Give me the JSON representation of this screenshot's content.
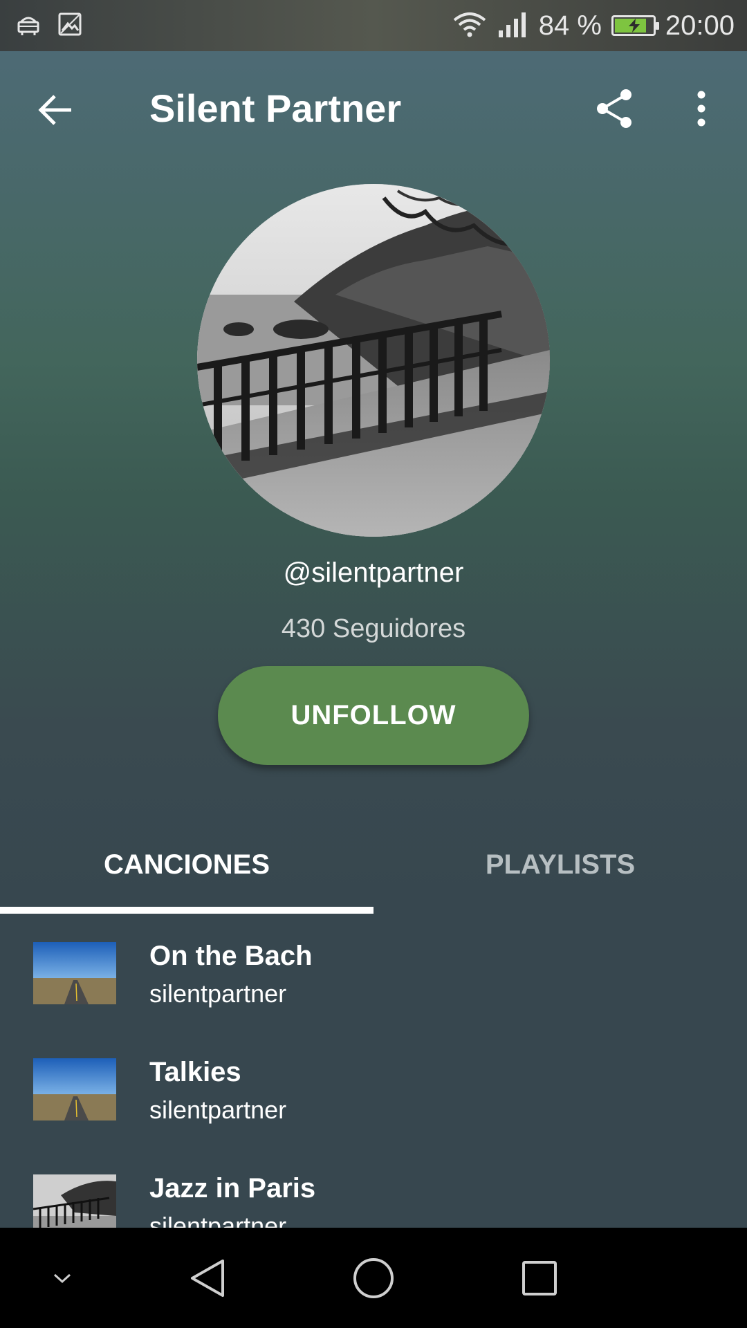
{
  "status_bar": {
    "battery_percent": "84 %",
    "battery_level": 0.84,
    "time": "20:00",
    "icons": [
      "android-icon",
      "image-icon",
      "wifi-icon",
      "signal-icon",
      "battery-charging-icon"
    ]
  },
  "toolbar": {
    "title": "Silent Partner",
    "back_icon": "arrow-back-icon",
    "share_icon": "share-icon",
    "more_icon": "more-vert-icon"
  },
  "profile": {
    "handle": "@silentpartner",
    "followers": "430 Seguidores",
    "unfollow_label": "UNFOLLOW"
  },
  "tabs": [
    {
      "label": "CANCIONES",
      "selected": true
    },
    {
      "label": "PLAYLISTS",
      "selected": false
    }
  ],
  "songs": [
    {
      "title": "On the Bach",
      "artist": "silentpartner"
    },
    {
      "title": "Talkies",
      "artist": "silentpartner"
    },
    {
      "title": "Jazz in Paris",
      "artist": "silentpartner"
    }
  ],
  "colors": {
    "accent_button": "#5b8a4f",
    "background": "#37474f",
    "header_top": "#4f6b79",
    "header_mid": "#43665c"
  }
}
